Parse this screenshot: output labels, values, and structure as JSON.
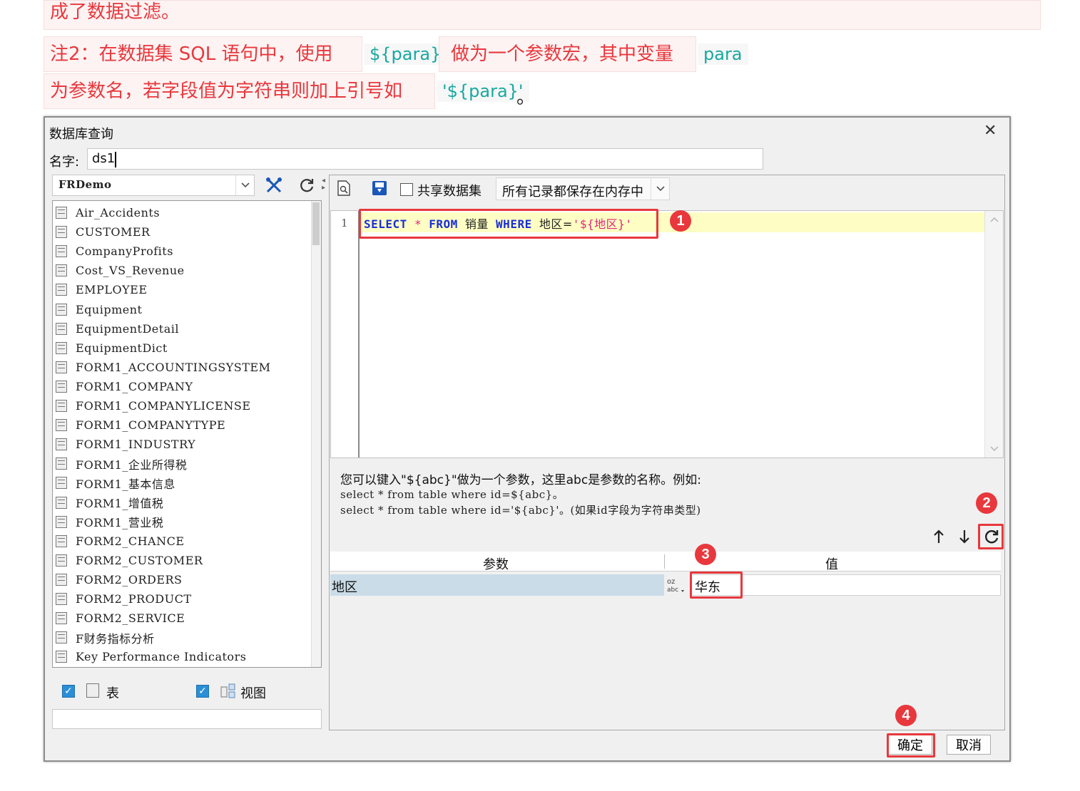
{
  "notes": {
    "line0": "成了数据过滤。",
    "line1_prefix": "注2：在数据集 SQL 语句中，使用",
    "line1_code": "${para}",
    "line1_mid": "做为一个参数宏，其中变量",
    "line1_var": "para",
    "line2_prefix": "为参数名，若字段值为字符串则加上引号如",
    "line2_code": "'${para}'",
    "line2_suffix": "。"
  },
  "dialog": {
    "title": "数据库查询",
    "close_glyph": "✕",
    "name_label": "名字:",
    "name_value": "ds1",
    "connection": "FRDemo",
    "tables": [
      "Air_Accidents",
      "CUSTOMER",
      "CompanyProfits",
      "Cost_VS_Revenue",
      "EMPLOYEE",
      "Equipment",
      "EquipmentDetail",
      "EquipmentDict",
      "FORM1_ACCOUNTINGSYSTEM",
      "FORM1_COMPANY",
      "FORM1_COMPANYLICENSE",
      "FORM1_COMPANYTYPE",
      "FORM1_INDUSTRY",
      "FORM1_企业所得税",
      "FORM1_基本信息",
      "FORM1_增值税",
      "FORM1_营业税",
      "FORM2_CHANCE",
      "FORM2_CUSTOMER",
      "FORM2_ORDERS",
      "FORM2_PRODUCT",
      "FORM2_SERVICE",
      "F财务指标分析",
      "Key Performance Indicators"
    ],
    "filter_table_label": "表",
    "filter_view_label": "视图",
    "share_label": "共享数据集",
    "memory_option": "所有记录都保存在内存中",
    "sql": {
      "line_no": "1",
      "kw_select": "SELECT",
      "star": "*",
      "kw_from": "FROM",
      "table": "销量",
      "kw_where": "WHERE",
      "field": "地区=",
      "value": "'${地区}'"
    },
    "hint": {
      "line1": "您可以键入\"${abc}\"做为一个参数，这里abc是参数的名称。例如:",
      "line2": "select * from table where id=${abc}。",
      "line3": "select * from table where id='${abc}'。(如果id字段为字符串类型)"
    },
    "param_table": {
      "col_param": "参数",
      "col_value": "值",
      "rows": [
        {
          "name": "地区",
          "value": "华东"
        }
      ]
    },
    "ok_label": "确定",
    "cancel_label": "取消",
    "badges": [
      "1",
      "2",
      "3",
      "4"
    ]
  },
  "colors": {
    "accent_red": "#e8383d",
    "code_teal": "#18a8a0",
    "sql_keyword": "#1a2fd6",
    "sql_string": "#e0257c",
    "param_row_bg": "#c9dce8",
    "sql_line_highlight": "#fefec4"
  }
}
